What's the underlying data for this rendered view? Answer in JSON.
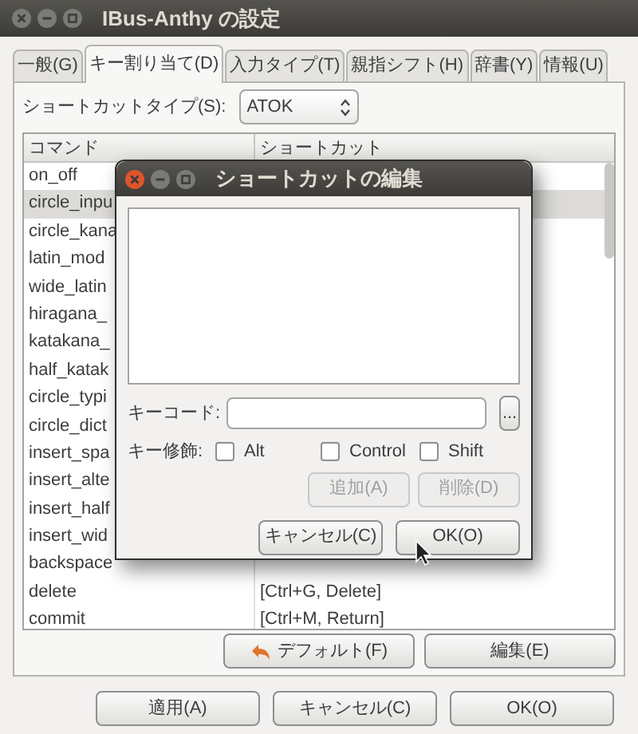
{
  "window": {
    "title": "IBus-Anthy の設定"
  },
  "tabs": [
    {
      "label": "一般(G)",
      "selected": false
    },
    {
      "label": "キー割り当て(D)",
      "selected": true
    },
    {
      "label": "入力タイプ(T)",
      "selected": false
    },
    {
      "label": "親指シフト(H)",
      "selected": false
    },
    {
      "label": "辞書(Y)",
      "selected": false
    },
    {
      "label": "情報(U)",
      "selected": false
    }
  ],
  "shortcut_type": {
    "label": "ショートカットタイプ(S):",
    "value": "ATOK"
  },
  "table": {
    "columns": [
      "コマンド",
      "ショートカット"
    ],
    "rows": [
      {
        "command": "on_off",
        "selected": false
      },
      {
        "command": "circle_inpu",
        "selected": true
      },
      {
        "command": "circle_kana",
        "selected": false
      },
      {
        "command": "latin_mod",
        "selected": false
      },
      {
        "command": "wide_latin",
        "selected": false
      },
      {
        "command": "hiragana_",
        "selected": false
      },
      {
        "command": "katakana_",
        "selected": false
      },
      {
        "command": "half_katak",
        "selected": false
      },
      {
        "command": "circle_typi",
        "selected": false
      },
      {
        "command": "circle_dict",
        "selected": false
      },
      {
        "command": "insert_spa",
        "selected": false
      },
      {
        "command": "insert_alte",
        "selected": false
      },
      {
        "command": "insert_half",
        "selected": false
      },
      {
        "command": "insert_wid",
        "selected": false
      },
      {
        "command": "backspace",
        "selected": false
      },
      {
        "command": "delete",
        "shortcut": "[Ctrl+G, Delete]",
        "selected": false
      },
      {
        "command": "commit",
        "shortcut": "[Ctrl+M, Return]",
        "selected": false
      }
    ]
  },
  "panel_buttons": [
    {
      "label": "デフォルト(F)",
      "kind": "undo"
    },
    {
      "label": "編集(E)",
      "kind": "plain"
    }
  ],
  "buttons": [
    "適用(A)",
    "キャンセル(C)",
    "OK(O)"
  ],
  "dialog": {
    "title": "ショートカットの編集",
    "keycode": {
      "label": "キーコード:",
      "button": "..."
    },
    "modifiers": {
      "label": "キー修飾:",
      "options": [
        {
          "label": "Alt",
          "checked": false
        },
        {
          "label": "Control",
          "checked": false
        },
        {
          "label": "Shift",
          "checked": false
        }
      ]
    },
    "actions": [
      {
        "label": "追加(A)",
        "disabled": true
      },
      {
        "label": "削除(D)",
        "disabled": true
      }
    ],
    "buttons": [
      "キャンセル(C)",
      "OK(O)"
    ]
  }
}
